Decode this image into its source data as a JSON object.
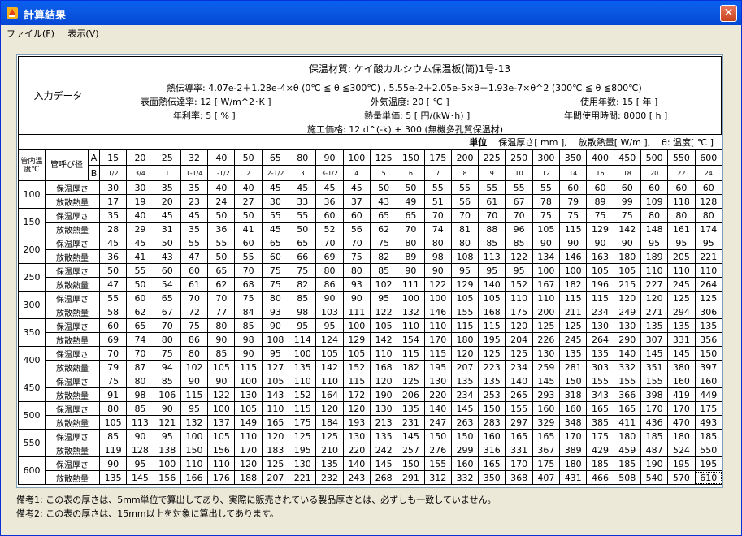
{
  "window": {
    "title": "計算結果",
    "close_label": "✕"
  },
  "menu": [
    {
      "label": "ファイル(F)"
    },
    {
      "label": "表示(V)"
    }
  ],
  "input_header": {
    "label": "入力データ",
    "material": "保温材質: ケイ酸カルシウム保温板(筒)1号-13",
    "conductivity": "熱伝導率: 4.07e-2＋1.28e-4×θ (0℃ ≦ θ ≦300℃) , 5.55e-2＋2.05e-5×θ＋1.93e-7×θ^2 (300℃ ≦ θ ≦800℃)",
    "surface_coef": "表面熱伝達率: 12 [ W/m^2･K ]",
    "outside_temp": "外気温度: 20 [ ℃ ]",
    "years": "使用年数: 15 [ 年 ]",
    "interest": "年利率: 5 [ % ]",
    "heat_price": "熱量単価: 5 [ 円/(kW･h) ]",
    "annual_hours": "年間使用時間: 8000 [ h ]",
    "construction_price": "施工価格: 12 d^(-k) + 300 (無機多孔質保温材)"
  },
  "units": {
    "label": "単位",
    "thickness": "保温厚さ[ mm ],",
    "heat": "放散熱量[ W/m ],",
    "temp": "θ: 温度[ ℃ ]"
  },
  "col_headers": {
    "temp": "管内温度℃",
    "nominal": "管呼び径",
    "a": "A",
    "b": "B"
  },
  "a_sizes": [
    "15",
    "20",
    "25",
    "32",
    "40",
    "50",
    "65",
    "80",
    "90",
    "100",
    "125",
    "150",
    "175",
    "200",
    "225",
    "250",
    "300",
    "350",
    "400",
    "450",
    "500",
    "550",
    "600"
  ],
  "b_sizes": [
    "1/2",
    "3/4",
    "1",
    "1-1/4",
    "1-1/2",
    "2",
    "2-1/2",
    "3",
    "3-1/2",
    "4",
    "5",
    "6",
    "7",
    "8",
    "9",
    "10",
    "12",
    "14",
    "16",
    "18",
    "20",
    "22",
    "24"
  ],
  "row_labels": {
    "thickness": "保温厚さ",
    "heat": "放散熱量"
  },
  "rows": [
    {
      "temp": "100",
      "thickness": [
        "30",
        "30",
        "35",
        "35",
        "40",
        "40",
        "45",
        "45",
        "45",
        "45",
        "50",
        "50",
        "55",
        "55",
        "55",
        "55",
        "55",
        "60",
        "60",
        "60",
        "60",
        "60",
        "60"
      ],
      "heat": [
        "17",
        "19",
        "20",
        "23",
        "24",
        "27",
        "30",
        "33",
        "36",
        "37",
        "43",
        "49",
        "51",
        "56",
        "61",
        "67",
        "78",
        "79",
        "89",
        "99",
        "109",
        "118",
        "128"
      ]
    },
    {
      "temp": "150",
      "thickness": [
        "35",
        "40",
        "45",
        "45",
        "50",
        "50",
        "55",
        "55",
        "60",
        "60",
        "65",
        "65",
        "70",
        "70",
        "70",
        "70",
        "75",
        "75",
        "75",
        "75",
        "80",
        "80",
        "80"
      ],
      "heat": [
        "28",
        "29",
        "31",
        "35",
        "36",
        "41",
        "45",
        "50",
        "52",
        "56",
        "62",
        "70",
        "74",
        "81",
        "88",
        "96",
        "105",
        "115",
        "129",
        "142",
        "148",
        "161",
        "174"
      ]
    },
    {
      "temp": "200",
      "thickness": [
        "45",
        "45",
        "50",
        "55",
        "55",
        "60",
        "65",
        "65",
        "70",
        "70",
        "75",
        "80",
        "80",
        "80",
        "85",
        "85",
        "90",
        "90",
        "90",
        "90",
        "95",
        "95",
        "95"
      ],
      "heat": [
        "36",
        "41",
        "43",
        "47",
        "50",
        "55",
        "60",
        "66",
        "69",
        "75",
        "82",
        "89",
        "98",
        "108",
        "113",
        "122",
        "134",
        "146",
        "163",
        "180",
        "189",
        "205",
        "221"
      ]
    },
    {
      "temp": "250",
      "thickness": [
        "50",
        "55",
        "60",
        "60",
        "65",
        "70",
        "75",
        "75",
        "80",
        "80",
        "85",
        "90",
        "90",
        "95",
        "95",
        "95",
        "100",
        "100",
        "105",
        "105",
        "110",
        "110",
        "110"
      ],
      "heat": [
        "47",
        "50",
        "54",
        "61",
        "62",
        "68",
        "75",
        "82",
        "86",
        "93",
        "102",
        "111",
        "122",
        "129",
        "140",
        "152",
        "167",
        "182",
        "196",
        "215",
        "227",
        "245",
        "264"
      ]
    },
    {
      "temp": "300",
      "thickness": [
        "55",
        "60",
        "65",
        "70",
        "70",
        "75",
        "80",
        "85",
        "90",
        "90",
        "95",
        "100",
        "100",
        "105",
        "105",
        "110",
        "110",
        "115",
        "115",
        "120",
        "120",
        "125",
        "125"
      ],
      "heat": [
        "58",
        "62",
        "67",
        "72",
        "77",
        "84",
        "93",
        "98",
        "103",
        "111",
        "122",
        "132",
        "146",
        "155",
        "168",
        "175",
        "200",
        "211",
        "234",
        "249",
        "271",
        "294",
        "306"
      ]
    },
    {
      "temp": "350",
      "thickness": [
        "60",
        "65",
        "70",
        "75",
        "80",
        "85",
        "90",
        "95",
        "95",
        "100",
        "105",
        "110",
        "110",
        "115",
        "115",
        "120",
        "125",
        "125",
        "130",
        "130",
        "135",
        "135",
        "135"
      ],
      "heat": [
        "69",
        "74",
        "80",
        "86",
        "90",
        "98",
        "108",
        "114",
        "124",
        "129",
        "142",
        "154",
        "170",
        "180",
        "195",
        "204",
        "226",
        "245",
        "264",
        "290",
        "307",
        "331",
        "356"
      ]
    },
    {
      "temp": "400",
      "thickness": [
        "70",
        "70",
        "75",
        "80",
        "85",
        "90",
        "95",
        "100",
        "105",
        "105",
        "110",
        "115",
        "115",
        "120",
        "125",
        "125",
        "130",
        "135",
        "135",
        "140",
        "145",
        "145",
        "150"
      ],
      "heat": [
        "79",
        "87",
        "94",
        "102",
        "105",
        "115",
        "127",
        "135",
        "142",
        "152",
        "168",
        "182",
        "195",
        "207",
        "223",
        "234",
        "259",
        "281",
        "303",
        "332",
        "351",
        "380",
        "397"
      ]
    },
    {
      "temp": "450",
      "thickness": [
        "75",
        "80",
        "85",
        "90",
        "90",
        "100",
        "105",
        "110",
        "110",
        "115",
        "120",
        "125",
        "130",
        "135",
        "135",
        "140",
        "145",
        "150",
        "155",
        "155",
        "155",
        "160",
        "160"
      ],
      "heat": [
        "91",
        "98",
        "106",
        "115",
        "122",
        "130",
        "143",
        "152",
        "164",
        "172",
        "190",
        "206",
        "220",
        "234",
        "253",
        "265",
        "293",
        "318",
        "343",
        "366",
        "398",
        "419",
        "449"
      ]
    },
    {
      "temp": "500",
      "thickness": [
        "80",
        "85",
        "90",
        "95",
        "100",
        "105",
        "110",
        "115",
        "120",
        "120",
        "130",
        "135",
        "140",
        "145",
        "150",
        "155",
        "160",
        "160",
        "165",
        "165",
        "170",
        "170",
        "175"
      ],
      "heat": [
        "105",
        "113",
        "121",
        "132",
        "137",
        "149",
        "165",
        "175",
        "184",
        "193",
        "213",
        "231",
        "247",
        "263",
        "283",
        "297",
        "329",
        "348",
        "385",
        "411",
        "436",
        "470",
        "493"
      ]
    },
    {
      "temp": "550",
      "thickness": [
        "85",
        "90",
        "95",
        "100",
        "105",
        "110",
        "120",
        "125",
        "125",
        "130",
        "135",
        "145",
        "150",
        "150",
        "160",
        "165",
        "165",
        "170",
        "175",
        "180",
        "185",
        "180",
        "185"
      ],
      "heat": [
        "119",
        "128",
        "138",
        "150",
        "156",
        "170",
        "183",
        "195",
        "210",
        "220",
        "242",
        "257",
        "276",
        "299",
        "316",
        "331",
        "367",
        "389",
        "429",
        "459",
        "487",
        "524",
        "550"
      ]
    },
    {
      "temp": "600",
      "thickness": [
        "90",
        "95",
        "100",
        "110",
        "110",
        "120",
        "125",
        "130",
        "135",
        "140",
        "145",
        "150",
        "155",
        "160",
        "165",
        "170",
        "175",
        "180",
        "185",
        "185",
        "190",
        "195",
        "195"
      ],
      "heat": [
        "135",
        "145",
        "156",
        "166",
        "176",
        "188",
        "207",
        "221",
        "232",
        "243",
        "268",
        "291",
        "312",
        "332",
        "350",
        "368",
        "407",
        "431",
        "466",
        "508",
        "540",
        "570",
        "610"
      ]
    }
  ],
  "notes": [
    "備考1:  この表の厚さは、5mm単位で算出してあり、実際に販売されている製品厚さとは、必ずしも一致していません。",
    "備考2:  この表の厚さは、15mm以上を対象に算出してあります。"
  ]
}
